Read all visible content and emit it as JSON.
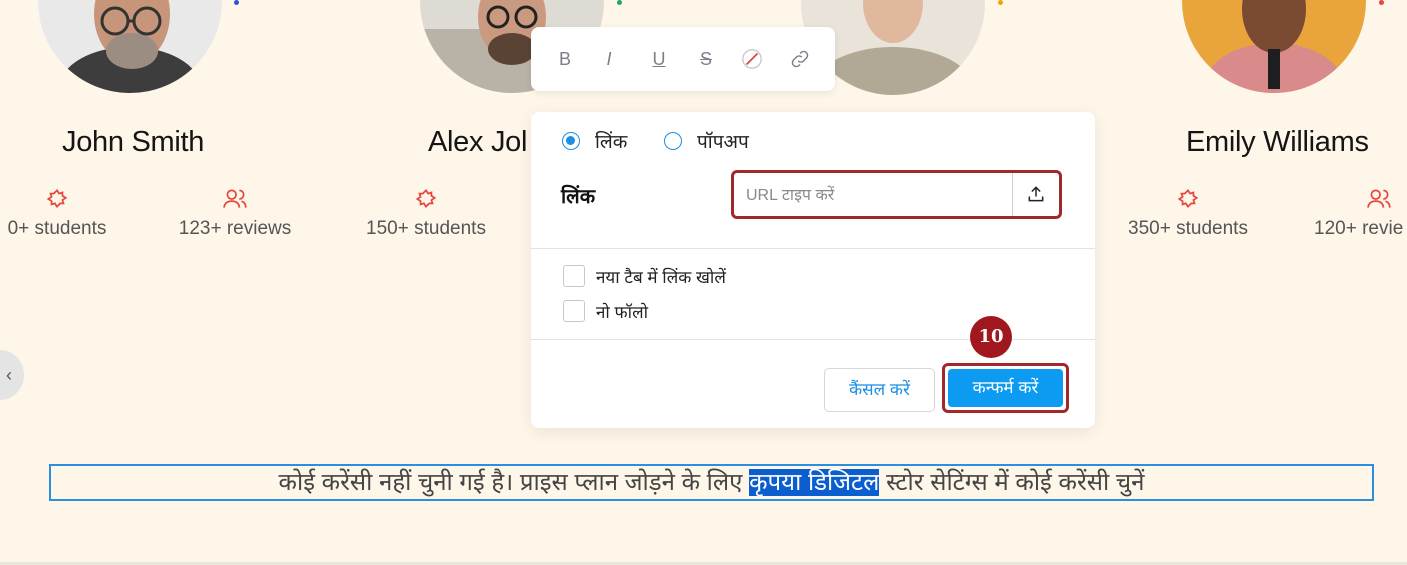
{
  "instructors": [
    {
      "name": "John Smith",
      "stats": [
        "0+ students",
        "123+ reviews"
      ]
    },
    {
      "name": "Alex Jol",
      "stats": [
        "150+ students"
      ]
    },
    {
      "name": "Emily Williams",
      "stats": [
        "350+ students",
        "120+ revie"
      ]
    }
  ],
  "carousel": {
    "prev_glyph": "‹"
  },
  "toolbar": {
    "bold": "B",
    "italic": "I",
    "underline": "U",
    "strike": "S"
  },
  "link_dialog": {
    "radio_link_label": "लिंक",
    "radio_popup_label": "पॉपअप",
    "selected": "link",
    "field_label": "लिंक",
    "url_placeholder": "URL टाइप करें",
    "url_value": "",
    "new_tab_label": "नया टैब में लिंक खोलें",
    "nofollow_label": "नो फॉलो",
    "cancel_label": "कैंसल करें",
    "confirm_label": "कन्फर्म करें"
  },
  "step_marker": "10",
  "editor_text": {
    "before": "कोई करेंसी नहीं चुनी गई है। प्राइस प्लान जोड़ने के लिए ",
    "selected": "कृपया डिजिटल",
    "after": " स्टोर सेटिंग्स में कोई करेंसी चुनें"
  },
  "colors": {
    "background": "#fdf6e9",
    "accent": "#0d9bf2",
    "highlight_border": "#a3282c",
    "icon_red": "#e8453c",
    "selection": "#0b5ed0"
  }
}
